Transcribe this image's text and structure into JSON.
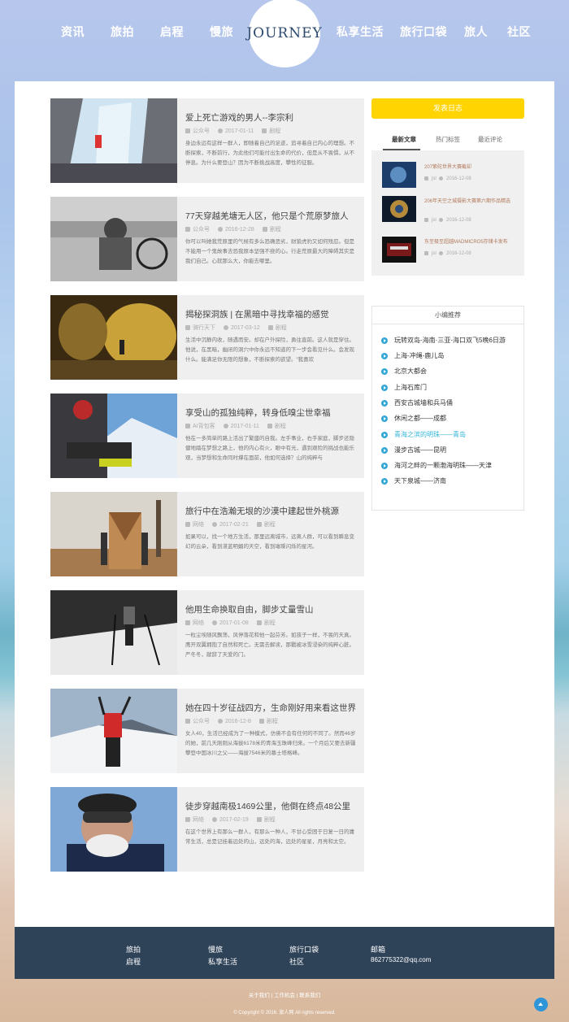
{
  "nav": {
    "left_items": [
      "资讯",
      "旅拍",
      "启程",
      "慢旅"
    ],
    "logo_text": "JOURNEY",
    "right_items": [
      "私享生活",
      "旅行口袋",
      "旅人",
      "社区"
    ]
  },
  "articles": [
    {
      "title": "爱上死亡游戏的男人--李宗利",
      "author": "公众号",
      "date": "2017-01-11",
      "category": "剧程",
      "excerpt": "身边永远有这样一群人，即随着自己的足迹，追寻着自己内心的理想。不断探索，不断前行，为此他们可能付出生命的代价，但是从不畏惧，从不停息。为什么要登山？因为不断挑战高度，攀性的征服。"
    },
    {
      "title": "77天穿越羌塘无人区，他只是个荒原梦旅人",
      "author": "公众号",
      "date": "2016-12-28",
      "category": "剧程",
      "excerpt": "你可以叫她我荒原里的气候有多么恐确恶劣，财狼虎豹又如何残忍。但是不能用一个鬼故事去恐我原本坚强不挠的心。行走荒原最大的障碍其实是我们自己。心就那么大，你能去哪里。"
    },
    {
      "title": "揭秘探洞族 | 在黑暗中寻找幸福的感觉",
      "author": "骑行天下",
      "date": "2017-03-12",
      "category": "剧程",
      "excerpt": "生活中沉静内收，随遇而安。却在户外探险，勇往直前。这人就是穿住。他说，在黑暗，幽闭的洞穴中你永远不知道的下一步会看见什么。会发现什么。能满足你无限的想象，不断探索的欲望。“我喜欢"
    },
    {
      "title": "享受山的孤独纯粹，转身低嗅尘世幸福",
      "author": "AI背包客",
      "date": "2017-01-11",
      "category": "剧程",
      "excerpt": "他在一多简单的路上活出了繁盛的自我。左手事业，右手家庭，脚步还隐健地踏在梦想之路上，他的内心有火，眼中有光，遇到艰险的挑战也能乐观，当梦想和生命同时撑在面前，他如何选择？山的纯粹与"
    },
    {
      "title": "旅行中在浩瀚无垠的沙漠中建起世外桃源",
      "author": "网络",
      "date": "2017-02-21",
      "category": "剧程",
      "excerpt": "如果可以，找一个地方生活，那里远离城市，远离人群，可以看到瞬息变幻的云朵，看到湛蓝明媚的天空，看到璀璨闪烁的星河。"
    },
    {
      "title": "他用生命换取自由，脚步丈量雪山",
      "author": "网络",
      "date": "2017-01-08",
      "category": "剧程",
      "excerpt": "一粒尘埃随风飘荡，风停落花和他一起芬芳。如孩子一样，不畏的天真。鹰开双翼拥抱了自然和死亡。无需去解读，那戳被冰雪浸染的纯粹心脏。严冬冬，献辞了天爱的门。"
    },
    {
      "title": "她在四十岁征战四方，生命刚好用来看这世界",
      "author": "公众号",
      "date": "2016-12-8",
      "category": "剧程",
      "excerpt": "女人40，生活已经成为了一种模式，仿佛不会有任何的不同了。然而46岁的她，前几天刚刚从海拔6178米的青海玉珠峰归来。一个月后又要去新疆攀登中国冰川之父——海拔7546米的慕士塔格峰。"
    },
    {
      "title": "徒步穿越南极1469公里，他倒在终点48公里",
      "author": "网络",
      "date": "2017-02-19",
      "category": "剧程",
      "excerpt": "在这个世界上有那么一群人，有那么一种人，不甘心受困于日复一日的庸常生活，总是记挂着远处的山，远处的海，远处的星星，月亮和太空。"
    }
  ],
  "sidebar": {
    "post_button": "发表日志",
    "tabs": [
      "最新文章",
      "热门标签",
      "最近评论"
    ],
    "new_posts": [
      {
        "title": "207紫砣世界大赛截却",
        "author": "jsl",
        "date": "2016-12-08"
      },
      {
        "title": "206年天空之城摄影大赛第六期作品精选",
        "author": "jsl",
        "date": "2016-12-08"
      },
      {
        "title": "东至极至超越MADMICRO5存储卡发布",
        "author": "jsl",
        "date": "2016-12-08"
      }
    ],
    "recommend_title": "小编推荐",
    "recommend": [
      "玩转双岛-海南·三亚-海口双飞5晚6日游",
      "上海-冲绳-鹿儿岛",
      "北京大都会",
      "上海石库门",
      "西安古城墙和兵马俑",
      "休闲之都——成都",
      "青海之滨的明珠——青岛",
      "漫步古城——昆明",
      "海河之畔的一颗渤海明珠——天津",
      "天下泉城——济南"
    ]
  },
  "footer": {
    "col1": [
      "旅拍",
      "启程"
    ],
    "col2": [
      "慢旅",
      "私享生活"
    ],
    "col3": [
      "旅行口袋",
      "社区"
    ],
    "col4": [
      "邮箱",
      "862775322@qq.com"
    ],
    "bottom_links": "关于我们 | 工作机会 | 联系我们",
    "copyright": "© Copyright © 2016. 旅人网 All rights reserved."
  }
}
